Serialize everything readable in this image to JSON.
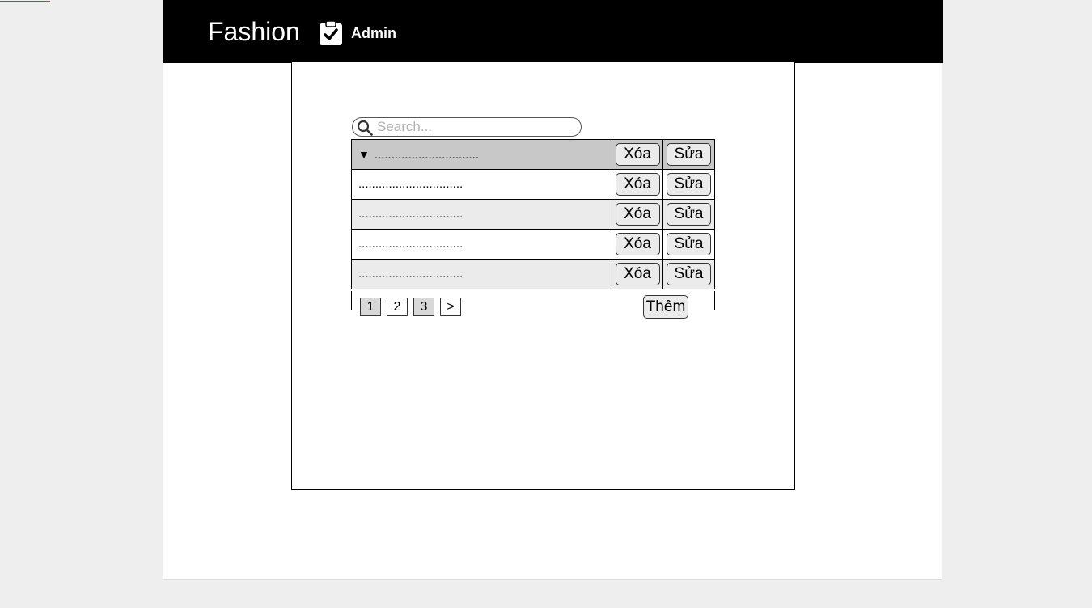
{
  "header": {
    "brand": "Fashion",
    "admin_label": "Admin",
    "admin_icon": "clipboard-check-icon"
  },
  "search": {
    "placeholder": "Search...",
    "icon": "search-icon"
  },
  "table": {
    "caret": "▼",
    "rows": [
      {
        "text": "...............................",
        "delete_label": "Xóa",
        "edit_label": "Sửa"
      },
      {
        "text": "...............................",
        "delete_label": "Xóa",
        "edit_label": "Sửa"
      },
      {
        "text": "...............................",
        "delete_label": "Xóa",
        "edit_label": "Sửa"
      },
      {
        "text": "...............................",
        "delete_label": "Xóa",
        "edit_label": "Sửa"
      },
      {
        "text": "...............................",
        "delete_label": "Xóa",
        "edit_label": "Sửa"
      }
    ]
  },
  "pagination": {
    "pages": [
      "1",
      "2",
      "3"
    ],
    "next": ">"
  },
  "add_label": "Thêm"
}
